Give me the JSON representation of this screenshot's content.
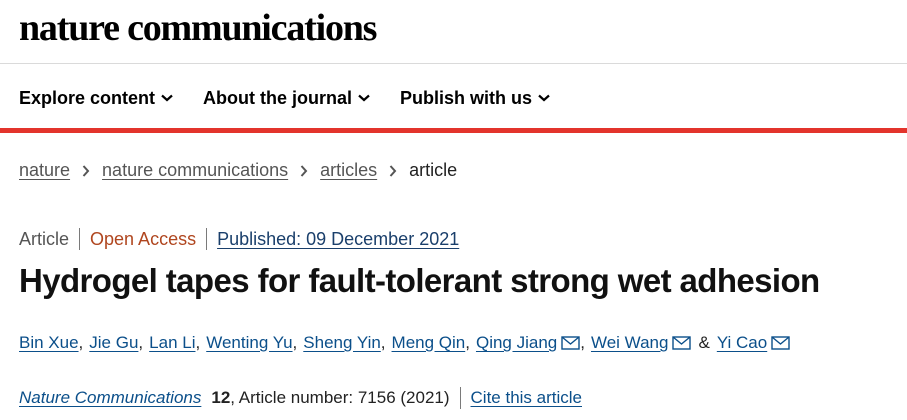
{
  "site": {
    "brand": "nature communications"
  },
  "nav": {
    "items": [
      {
        "label": "Explore content"
      },
      {
        "label": "About the journal"
      },
      {
        "label": "Publish with us"
      }
    ]
  },
  "colors": {
    "accent": "#e3342c",
    "link": "#0b4f8a",
    "open_access": "#b0461f",
    "published": "#1a3f6b"
  },
  "breadcrumb": {
    "items": [
      {
        "label": "nature"
      },
      {
        "label": "nature communications"
      },
      {
        "label": "articles"
      }
    ],
    "current": "article"
  },
  "article": {
    "type": "Article",
    "access": "Open Access",
    "published": "Published: 09 December 2021",
    "title": "Hydrogel tapes for fault-tolerant strong wet adhesion",
    "authors": [
      {
        "name": "Bin Xue",
        "email_icon": false
      },
      {
        "name": "Jie Gu",
        "email_icon": false
      },
      {
        "name": "Lan Li",
        "email_icon": false
      },
      {
        "name": "Wenting Yu",
        "email_icon": false
      },
      {
        "name": "Sheng Yin",
        "email_icon": false
      },
      {
        "name": "Meng Qin",
        "email_icon": false
      },
      {
        "name": "Qing Jiang",
        "email_icon": true
      },
      {
        "name": "Wei Wang",
        "email_icon": true
      },
      {
        "name": "Yi Cao",
        "email_icon": true
      }
    ],
    "author_separator": ",",
    "author_last_separator": "&",
    "citation": {
      "journal": "Nature Communications",
      "volume": "12",
      "article_number_text": ", Article number: 7156 (2021)",
      "cite_label": "Cite this article"
    }
  }
}
